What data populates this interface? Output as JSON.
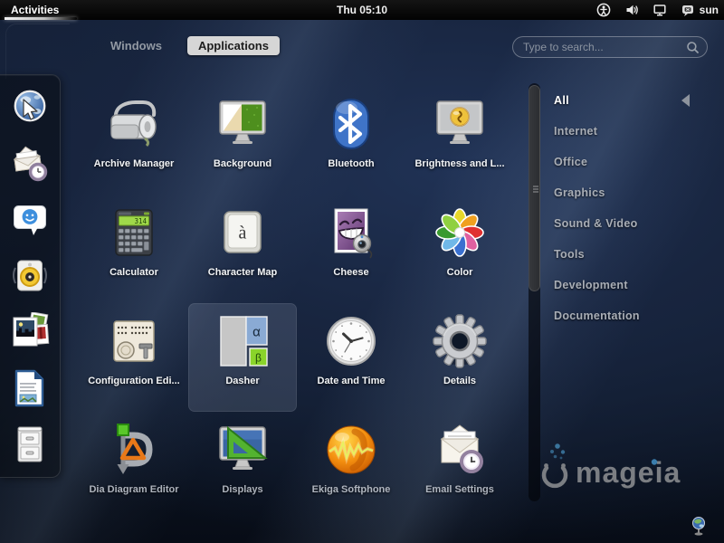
{
  "top_bar": {
    "activities_label": "Activities",
    "clock": "Thu 05:10",
    "username": "sun",
    "status_icons": [
      "accessibility-icon",
      "volume-icon",
      "display-icon",
      "im-status-icon"
    ]
  },
  "view_switcher": {
    "tabs": [
      {
        "label": "Windows",
        "selected": false
      },
      {
        "label": "Applications",
        "selected": true
      }
    ]
  },
  "search": {
    "placeholder": "Type to search..."
  },
  "dock": {
    "items": [
      {
        "name": "web-browser"
      },
      {
        "name": "email-client"
      },
      {
        "name": "instant-messenger"
      },
      {
        "name": "music-player"
      },
      {
        "name": "photo-manager"
      },
      {
        "name": "word-processor"
      },
      {
        "name": "file-manager"
      }
    ]
  },
  "app_grid": {
    "apps": [
      {
        "label": "Archive Manager"
      },
      {
        "label": "Background"
      },
      {
        "label": "Bluetooth"
      },
      {
        "label": "Brightness and L..."
      },
      {
        "label": "Calculator"
      },
      {
        "label": "Character Map"
      },
      {
        "label": "Cheese"
      },
      {
        "label": "Color"
      },
      {
        "label": "Configuration Edi..."
      },
      {
        "label": "Dasher",
        "highlighted": true
      },
      {
        "label": "Date and Time"
      },
      {
        "label": "Details"
      },
      {
        "label": "Dia Diagram Editor"
      },
      {
        "label": "Displays"
      },
      {
        "label": "Ekiga Softphone"
      },
      {
        "label": "Email Settings"
      }
    ],
    "icon_glyphs": {
      "calculator_display": "314",
      "character_map_glyph": "à",
      "dasher_alpha": "α",
      "dasher_beta": "β"
    }
  },
  "categories": {
    "items": [
      {
        "label": "All",
        "selected": true
      },
      {
        "label": "Internet",
        "selected": false
      },
      {
        "label": "Office",
        "selected": false
      },
      {
        "label": "Graphics",
        "selected": false
      },
      {
        "label": "Sound & Video",
        "selected": false
      },
      {
        "label": "Tools",
        "selected": false
      },
      {
        "label": "Development",
        "selected": false
      },
      {
        "label": "Documentation",
        "selected": false
      }
    ]
  },
  "branding": {
    "logo_text": "mageia"
  },
  "colors": {
    "top_bar_bg": "#0a0a0a",
    "background_base": "#131e33",
    "selected_tab_bg": "#d6d6d6",
    "app_label": "#f2f4f6",
    "category_text": "#a9aeb6",
    "selected_category_text": "#ffffff",
    "mageia_gray": "#85878b",
    "mageia_blue": "#3e86b8"
  }
}
